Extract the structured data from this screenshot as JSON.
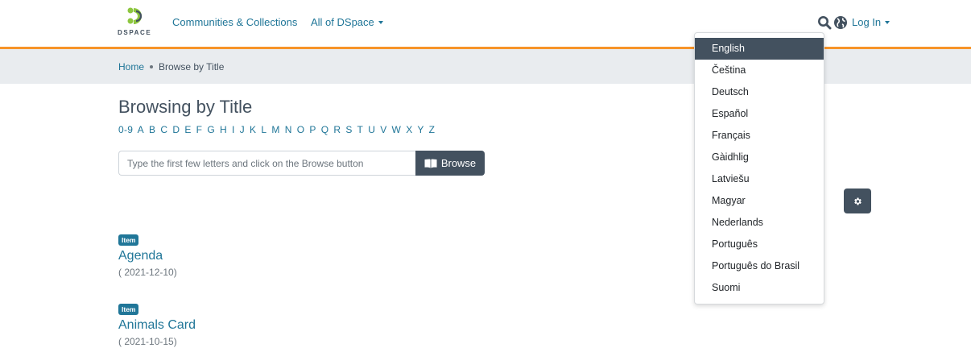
{
  "colors": {
    "primary": "#43515f",
    "link": "#207698",
    "accent": "#f79429",
    "breadcrumb_bg": "#e9ecef"
  },
  "header": {
    "logo_text": "DSPACE",
    "nav": {
      "communities": "Communities & Collections",
      "all_dspace": "All of DSpace"
    },
    "search_icon": "search-icon",
    "language_icon": "globe-icon",
    "login": "Log In"
  },
  "breadcrumb": {
    "home": "Home",
    "current": "Browse by Title"
  },
  "main": {
    "title": "Browsing by Title",
    "alphabet": [
      "0-9",
      "A",
      "B",
      "C",
      "D",
      "E",
      "F",
      "G",
      "H",
      "I",
      "J",
      "K",
      "L",
      "M",
      "N",
      "O",
      "P",
      "Q",
      "R",
      "S",
      "T",
      "U",
      "V",
      "W",
      "X",
      "Y",
      "Z"
    ],
    "search": {
      "placeholder": "Type the first few letters and click on the Browse button",
      "value": ""
    },
    "browse_button": "Browse",
    "settings_icon": "gear-icon",
    "items": [
      {
        "badge": "Item",
        "title": "Agenda",
        "date": "( 2021-12-10)"
      },
      {
        "badge": "Item",
        "title": "Animals Card",
        "date": "( 2021-10-15)"
      }
    ]
  },
  "language_menu": {
    "selected": "English",
    "options": [
      "English",
      "Čeština",
      "Deutsch",
      "Español",
      "Français",
      "Gàidhlig",
      "Latviešu",
      "Magyar",
      "Nederlands",
      "Português",
      "Português do Brasil",
      "Suomi"
    ]
  }
}
